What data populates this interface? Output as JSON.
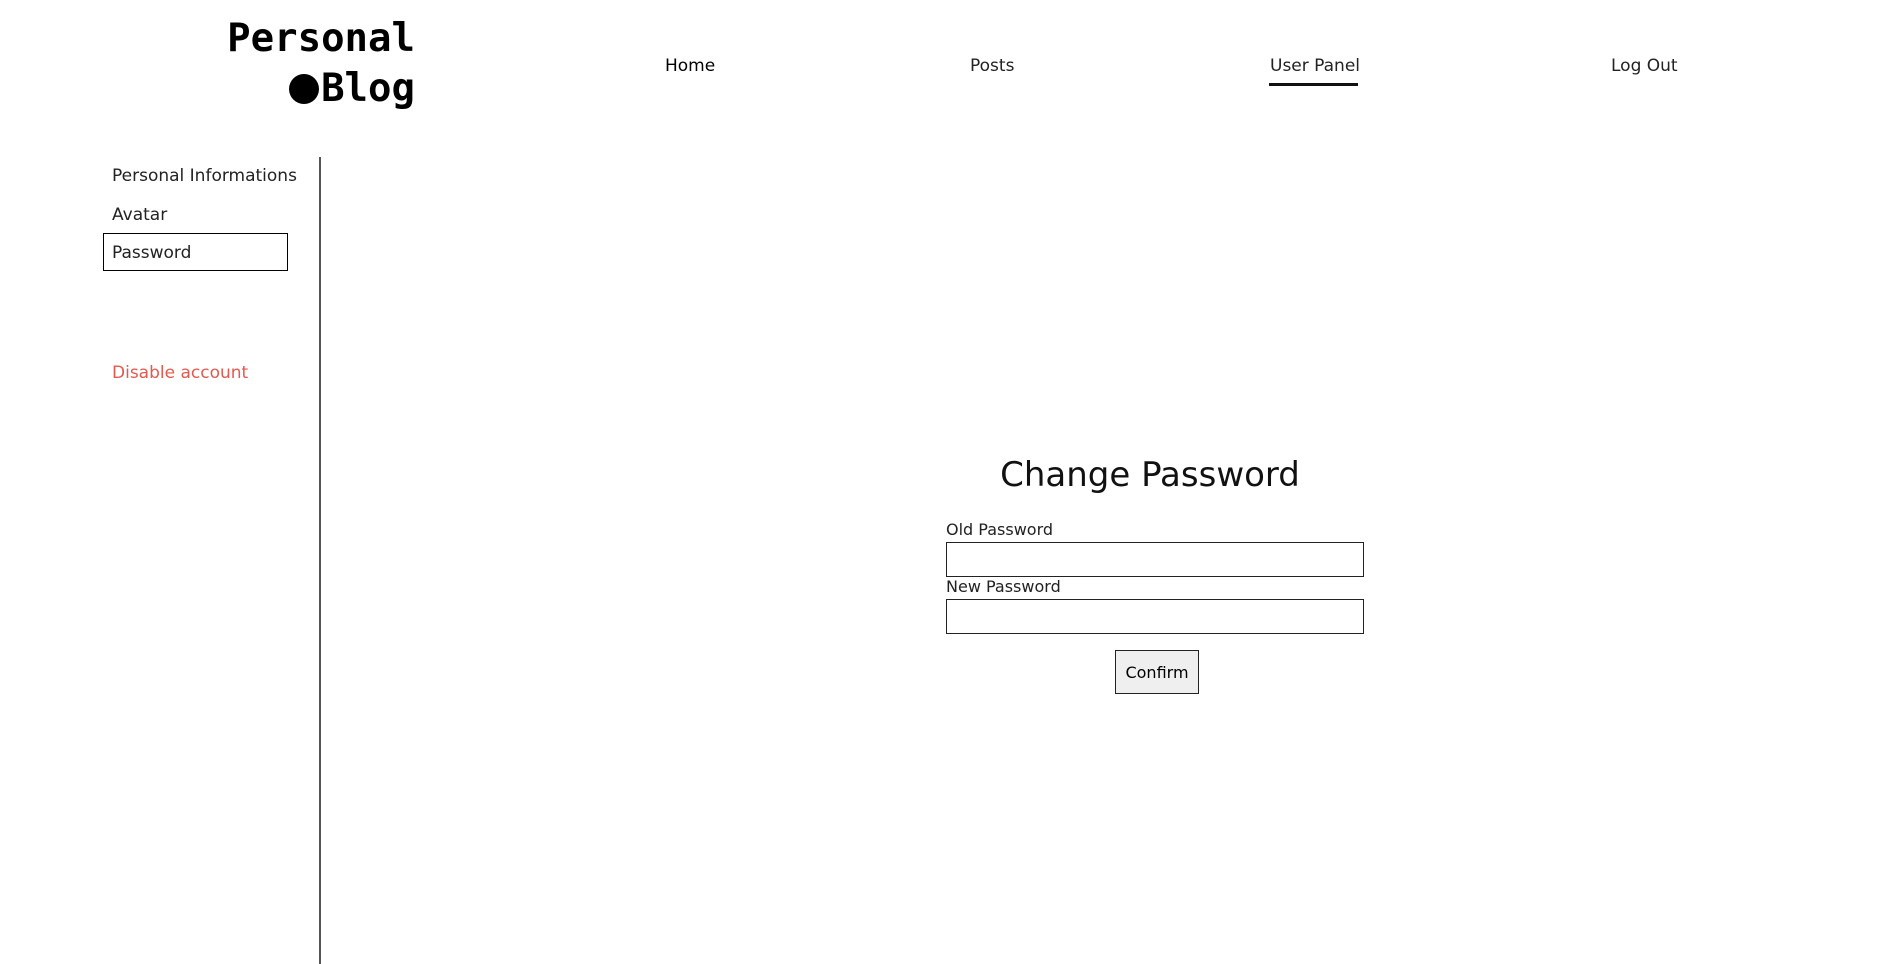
{
  "header": {
    "logo_line1": "Personal",
    "logo_line2": "Blog"
  },
  "nav": {
    "items": [
      {
        "label": "Home"
      },
      {
        "label": "Posts"
      },
      {
        "label": "User Panel",
        "active": true
      },
      {
        "label": "Log Out"
      }
    ]
  },
  "sidebar": {
    "items": [
      {
        "label": "Personal Informations"
      },
      {
        "label": "Avatar"
      },
      {
        "label": "Password",
        "active": true
      }
    ],
    "disable_label": "Disable account",
    "disable_color": "#e05a4f"
  },
  "form": {
    "title": "Change Password",
    "old_label": "Old Password",
    "old_value": "",
    "new_label": "New Password",
    "new_value": "",
    "confirm_label": "Confirm"
  }
}
